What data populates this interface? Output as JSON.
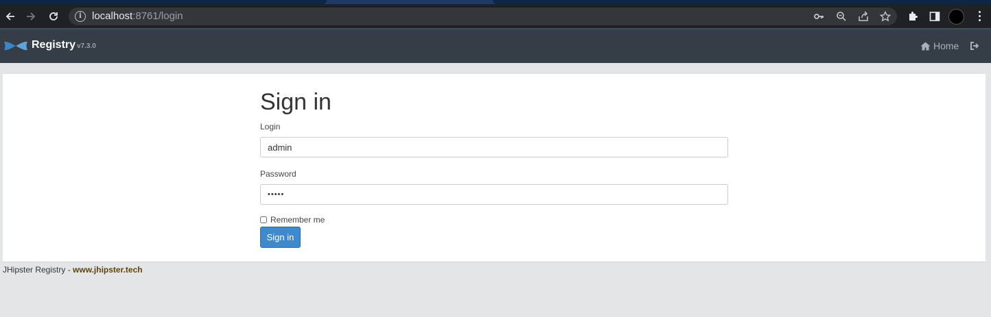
{
  "browser": {
    "url_host": "localhost",
    "url_port_path": ":8761/login"
  },
  "navbar": {
    "brand_title": "Registry",
    "brand_version": "v7.3.0",
    "home_label": "Home"
  },
  "login_form": {
    "title": "Sign in",
    "login_label": "Login",
    "login_value": "admin",
    "password_label": "Password",
    "password_value": "•••••",
    "remember_label": "Remember me",
    "remember_checked": false,
    "submit_label": "Sign in"
  },
  "footer": {
    "text": "JHipster Registry - ",
    "link_label": "www.jhipster.tech"
  },
  "colors": {
    "navbar_bg": "#353d47",
    "primary_button": "#3e8acc",
    "page_bg": "#e4e5e6"
  }
}
